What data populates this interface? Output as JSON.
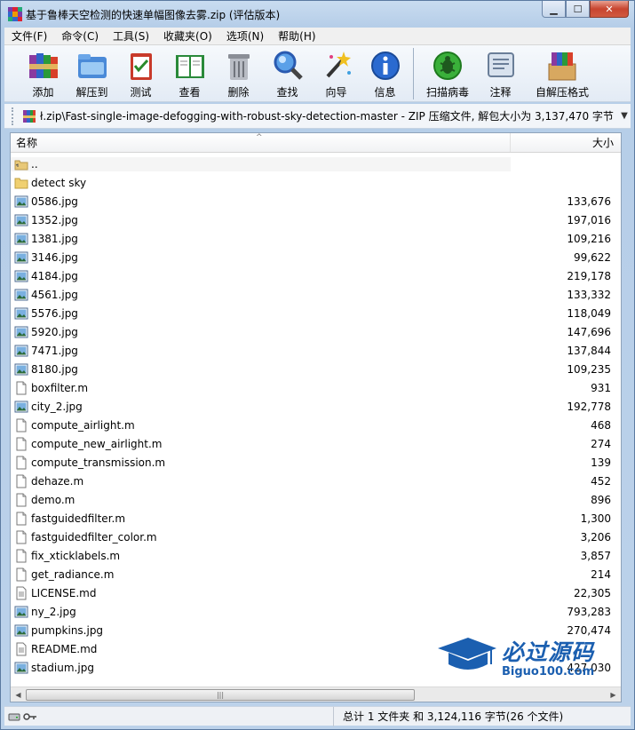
{
  "window": {
    "title": "基于鲁棒天空检测的快速单幅图像去雾.zip (评估版本)",
    "min_glyph": "▁",
    "max_glyph": "☐",
    "close_glyph": "✕"
  },
  "menu": [
    "文件(F)",
    "命令(C)",
    "工具(S)",
    "收藏夹(O)",
    "选项(N)",
    "帮助(H)"
  ],
  "toolbar": {
    "buttons": [
      {
        "label": "添加",
        "icon": "add-books-icon"
      },
      {
        "label": "解压到",
        "icon": "extract-folder-icon"
      },
      {
        "label": "测试",
        "icon": "test-clipboard-icon"
      },
      {
        "label": "查看",
        "icon": "view-book-icon"
      },
      {
        "label": "删除",
        "icon": "trash-icon"
      },
      {
        "label": "查找",
        "icon": "magnifier-icon"
      },
      {
        "label": "向导",
        "icon": "wizard-wand-icon"
      },
      {
        "label": "信息",
        "icon": "info-icon"
      },
      {
        "label": "扫描病毒",
        "icon": "virus-scan-icon"
      },
      {
        "label": "注释",
        "icon": "comment-icon"
      },
      {
        "label": "自解压格式",
        "icon": "sfx-box-icon"
      }
    ]
  },
  "address": {
    "path": "ł.zip\\Fast-single-image-defogging-with-robust-sky-detection-master - ZIP 压缩文件, 解包大小为 3,137,470 字节",
    "dropdown_glyph": "▼"
  },
  "columns": {
    "name": "名称",
    "size": "大小",
    "sort_glyph": "^"
  },
  "files": [
    {
      "name": "..",
      "size": "",
      "type": "parent"
    },
    {
      "name": "detect sky",
      "size": "",
      "type": "folder"
    },
    {
      "name": "0586.jpg",
      "size": "133,676",
      "type": "image"
    },
    {
      "name": "1352.jpg",
      "size": "197,016",
      "type": "image"
    },
    {
      "name": "1381.jpg",
      "size": "109,216",
      "type": "image"
    },
    {
      "name": "3146.jpg",
      "size": "99,622",
      "type": "image"
    },
    {
      "name": "4184.jpg",
      "size": "219,178",
      "type": "image"
    },
    {
      "name": "4561.jpg",
      "size": "133,332",
      "type": "image"
    },
    {
      "name": "5576.jpg",
      "size": "118,049",
      "type": "image"
    },
    {
      "name": "5920.jpg",
      "size": "147,696",
      "type": "image"
    },
    {
      "name": "7471.jpg",
      "size": "137,844",
      "type": "image"
    },
    {
      "name": "8180.jpg",
      "size": "109,235",
      "type": "image"
    },
    {
      "name": "boxfilter.m",
      "size": "931",
      "type": "m"
    },
    {
      "name": "city_2.jpg",
      "size": "192,778",
      "type": "image"
    },
    {
      "name": "compute_airlight.m",
      "size": "468",
      "type": "m"
    },
    {
      "name": "compute_new_airlight.m",
      "size": "274",
      "type": "m"
    },
    {
      "name": "compute_transmission.m",
      "size": "139",
      "type": "m"
    },
    {
      "name": "dehaze.m",
      "size": "452",
      "type": "m"
    },
    {
      "name": "demo.m",
      "size": "896",
      "type": "m"
    },
    {
      "name": "fastguidedfilter.m",
      "size": "1,300",
      "type": "m"
    },
    {
      "name": "fastguidedfilter_color.m",
      "size": "3,206",
      "type": "m"
    },
    {
      "name": "fix_xticklabels.m",
      "size": "3,857",
      "type": "m"
    },
    {
      "name": "get_radiance.m",
      "size": "214",
      "type": "m"
    },
    {
      "name": "LICENSE.md",
      "size": "22,305",
      "type": "md"
    },
    {
      "name": "ny_2.jpg",
      "size": "793,283",
      "type": "image"
    },
    {
      "name": "pumpkins.jpg",
      "size": "270,474",
      "type": "image"
    },
    {
      "name": "README.md",
      "size": "",
      "type": "md"
    },
    {
      "name": "stadium.jpg",
      "size": "427,030",
      "type": "image"
    }
  ],
  "scrollbar": {
    "left_glyph": "◀",
    "right_glyph": "▶",
    "grip_glyph": "|||"
  },
  "status": {
    "summary": "总计 1 文件夹 和 3,124,116 字节(26 个文件)"
  },
  "watermark": {
    "cn": "必过源码",
    "en": "Biguo100.com"
  }
}
